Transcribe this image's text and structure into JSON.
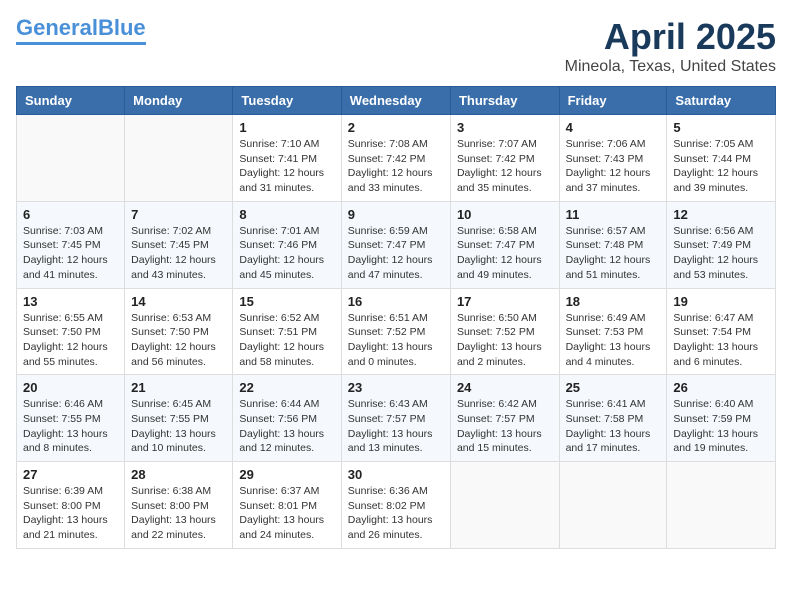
{
  "logo": {
    "line1": "General",
    "line2": "Blue"
  },
  "title": "April 2025",
  "location": "Mineola, Texas, United States",
  "days_of_week": [
    "Sunday",
    "Monday",
    "Tuesday",
    "Wednesday",
    "Thursday",
    "Friday",
    "Saturday"
  ],
  "weeks": [
    [
      {
        "day": "",
        "content": ""
      },
      {
        "day": "",
        "content": ""
      },
      {
        "day": "1",
        "content": "Sunrise: 7:10 AM\nSunset: 7:41 PM\nDaylight: 12 hours and 31 minutes."
      },
      {
        "day": "2",
        "content": "Sunrise: 7:08 AM\nSunset: 7:42 PM\nDaylight: 12 hours and 33 minutes."
      },
      {
        "day": "3",
        "content": "Sunrise: 7:07 AM\nSunset: 7:42 PM\nDaylight: 12 hours and 35 minutes."
      },
      {
        "day": "4",
        "content": "Sunrise: 7:06 AM\nSunset: 7:43 PM\nDaylight: 12 hours and 37 minutes."
      },
      {
        "day": "5",
        "content": "Sunrise: 7:05 AM\nSunset: 7:44 PM\nDaylight: 12 hours and 39 minutes."
      }
    ],
    [
      {
        "day": "6",
        "content": "Sunrise: 7:03 AM\nSunset: 7:45 PM\nDaylight: 12 hours and 41 minutes."
      },
      {
        "day": "7",
        "content": "Sunrise: 7:02 AM\nSunset: 7:45 PM\nDaylight: 12 hours and 43 minutes."
      },
      {
        "day": "8",
        "content": "Sunrise: 7:01 AM\nSunset: 7:46 PM\nDaylight: 12 hours and 45 minutes."
      },
      {
        "day": "9",
        "content": "Sunrise: 6:59 AM\nSunset: 7:47 PM\nDaylight: 12 hours and 47 minutes."
      },
      {
        "day": "10",
        "content": "Sunrise: 6:58 AM\nSunset: 7:47 PM\nDaylight: 12 hours and 49 minutes."
      },
      {
        "day": "11",
        "content": "Sunrise: 6:57 AM\nSunset: 7:48 PM\nDaylight: 12 hours and 51 minutes."
      },
      {
        "day": "12",
        "content": "Sunrise: 6:56 AM\nSunset: 7:49 PM\nDaylight: 12 hours and 53 minutes."
      }
    ],
    [
      {
        "day": "13",
        "content": "Sunrise: 6:55 AM\nSunset: 7:50 PM\nDaylight: 12 hours and 55 minutes."
      },
      {
        "day": "14",
        "content": "Sunrise: 6:53 AM\nSunset: 7:50 PM\nDaylight: 12 hours and 56 minutes."
      },
      {
        "day": "15",
        "content": "Sunrise: 6:52 AM\nSunset: 7:51 PM\nDaylight: 12 hours and 58 minutes."
      },
      {
        "day": "16",
        "content": "Sunrise: 6:51 AM\nSunset: 7:52 PM\nDaylight: 13 hours and 0 minutes."
      },
      {
        "day": "17",
        "content": "Sunrise: 6:50 AM\nSunset: 7:52 PM\nDaylight: 13 hours and 2 minutes."
      },
      {
        "day": "18",
        "content": "Sunrise: 6:49 AM\nSunset: 7:53 PM\nDaylight: 13 hours and 4 minutes."
      },
      {
        "day": "19",
        "content": "Sunrise: 6:47 AM\nSunset: 7:54 PM\nDaylight: 13 hours and 6 minutes."
      }
    ],
    [
      {
        "day": "20",
        "content": "Sunrise: 6:46 AM\nSunset: 7:55 PM\nDaylight: 13 hours and 8 minutes."
      },
      {
        "day": "21",
        "content": "Sunrise: 6:45 AM\nSunset: 7:55 PM\nDaylight: 13 hours and 10 minutes."
      },
      {
        "day": "22",
        "content": "Sunrise: 6:44 AM\nSunset: 7:56 PM\nDaylight: 13 hours and 12 minutes."
      },
      {
        "day": "23",
        "content": "Sunrise: 6:43 AM\nSunset: 7:57 PM\nDaylight: 13 hours and 13 minutes."
      },
      {
        "day": "24",
        "content": "Sunrise: 6:42 AM\nSunset: 7:57 PM\nDaylight: 13 hours and 15 minutes."
      },
      {
        "day": "25",
        "content": "Sunrise: 6:41 AM\nSunset: 7:58 PM\nDaylight: 13 hours and 17 minutes."
      },
      {
        "day": "26",
        "content": "Sunrise: 6:40 AM\nSunset: 7:59 PM\nDaylight: 13 hours and 19 minutes."
      }
    ],
    [
      {
        "day": "27",
        "content": "Sunrise: 6:39 AM\nSunset: 8:00 PM\nDaylight: 13 hours and 21 minutes."
      },
      {
        "day": "28",
        "content": "Sunrise: 6:38 AM\nSunset: 8:00 PM\nDaylight: 13 hours and 22 minutes."
      },
      {
        "day": "29",
        "content": "Sunrise: 6:37 AM\nSunset: 8:01 PM\nDaylight: 13 hours and 24 minutes."
      },
      {
        "day": "30",
        "content": "Sunrise: 6:36 AM\nSunset: 8:02 PM\nDaylight: 13 hours and 26 minutes."
      },
      {
        "day": "",
        "content": ""
      },
      {
        "day": "",
        "content": ""
      },
      {
        "day": "",
        "content": ""
      }
    ]
  ]
}
